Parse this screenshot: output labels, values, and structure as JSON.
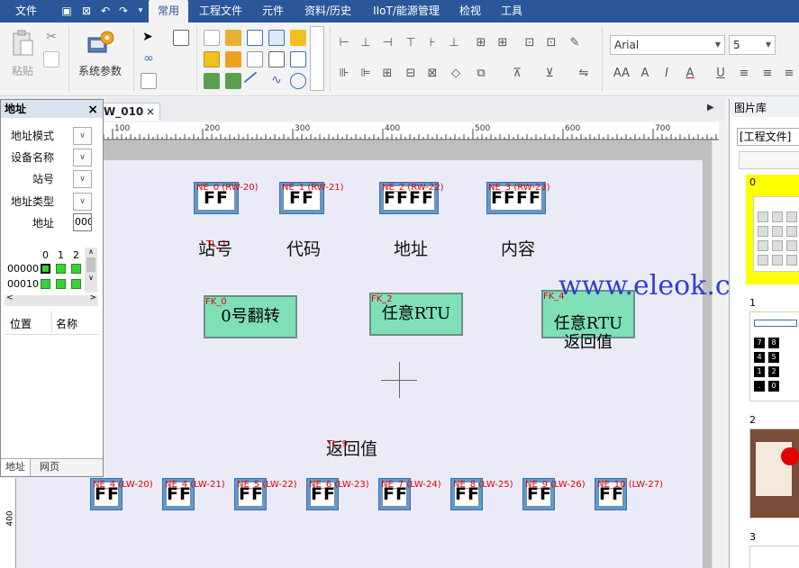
{
  "menu": {
    "items": [
      "文件",
      "常用",
      "工程文件",
      "元件",
      "资料/历史",
      "IIoT/能源管理",
      "检视",
      "工具"
    ],
    "active": "常用"
  },
  "ribbon": {
    "paste_label": "粘贴",
    "system_params_label": "系统参数",
    "font_name": "Arial",
    "font_size": "5",
    "format_labels": [
      "AA",
      "A",
      "I",
      "A",
      "U"
    ]
  },
  "doc_tab": {
    "label": "W_010",
    "close": "×"
  },
  "ruler": {
    "ticks": [
      "100",
      "200",
      "300",
      "400",
      "500",
      "600",
      "700"
    ],
    "vertical_label": "400"
  },
  "canvas": {
    "top_ne": [
      {
        "tag": "NE_0 (RW-20)",
        "value": "FF"
      },
      {
        "tag": "NE_1 (RW-21)",
        "value": "FF"
      },
      {
        "tag": "NE_2 (RW-22)",
        "value": "FFFF"
      },
      {
        "tag": "NE_3 (RW-23)",
        "value": "FFFF"
      }
    ],
    "labels": [
      "站号",
      "代码",
      "地址",
      "内容"
    ],
    "small_red_tag": "TL_1",
    "fk": [
      {
        "tag": "FK_0",
        "text": "0号翻转"
      },
      {
        "tag": "FK_2",
        "text": "任意RTU"
      },
      {
        "tag": "FK_4",
        "text": "任意RTU\n返回值"
      }
    ],
    "return_label": "返回值",
    "return_tag": "TL_9",
    "bottom_ne": [
      {
        "tag": "NE_4 (LW-20)",
        "value": "FF"
      },
      {
        "tag": "NE_4 (LW-21)",
        "value": "FF"
      },
      {
        "tag": "NE_5 (LW-22)",
        "value": "FF"
      },
      {
        "tag": "NE_6 (LW-23)",
        "value": "FF"
      },
      {
        "tag": "NE_7 (LW-24)",
        "value": "FF"
      },
      {
        "tag": "NE_8 (LW-25)",
        "value": "FF"
      },
      {
        "tag": "NE_9 (LW-26)",
        "value": "FF"
      },
      {
        "tag": "NE_10 (LW-27)",
        "value": "FF"
      }
    ],
    "watermark": "www.eleok.com"
  },
  "address_panel": {
    "title": "地址",
    "close": "×",
    "fields": [
      "地址模式",
      "设备名称",
      "站号",
      "地址类型",
      "地址"
    ],
    "address_value": "000",
    "bit_columns": [
      "0",
      "1",
      "2"
    ],
    "rows": [
      "00000",
      "00010"
    ],
    "col_headers": [
      "位置",
      "名称"
    ],
    "tabs": [
      "地址",
      "网页"
    ]
  },
  "picture_library": {
    "title": "图片库",
    "category": "[工程文件]",
    "items": [
      "0",
      "1",
      "2",
      "3"
    ],
    "keypad_digits": [
      "7",
      "8",
      "4",
      "5",
      "1",
      "2",
      ".",
      "0"
    ]
  },
  "colors": {
    "menu_bg": "#2b579a",
    "fk_green": "#7fe0b8",
    "ne_blue": "#5b9bd5",
    "tag_red": "#e00000",
    "canvas_bg": "#ebebf8"
  }
}
